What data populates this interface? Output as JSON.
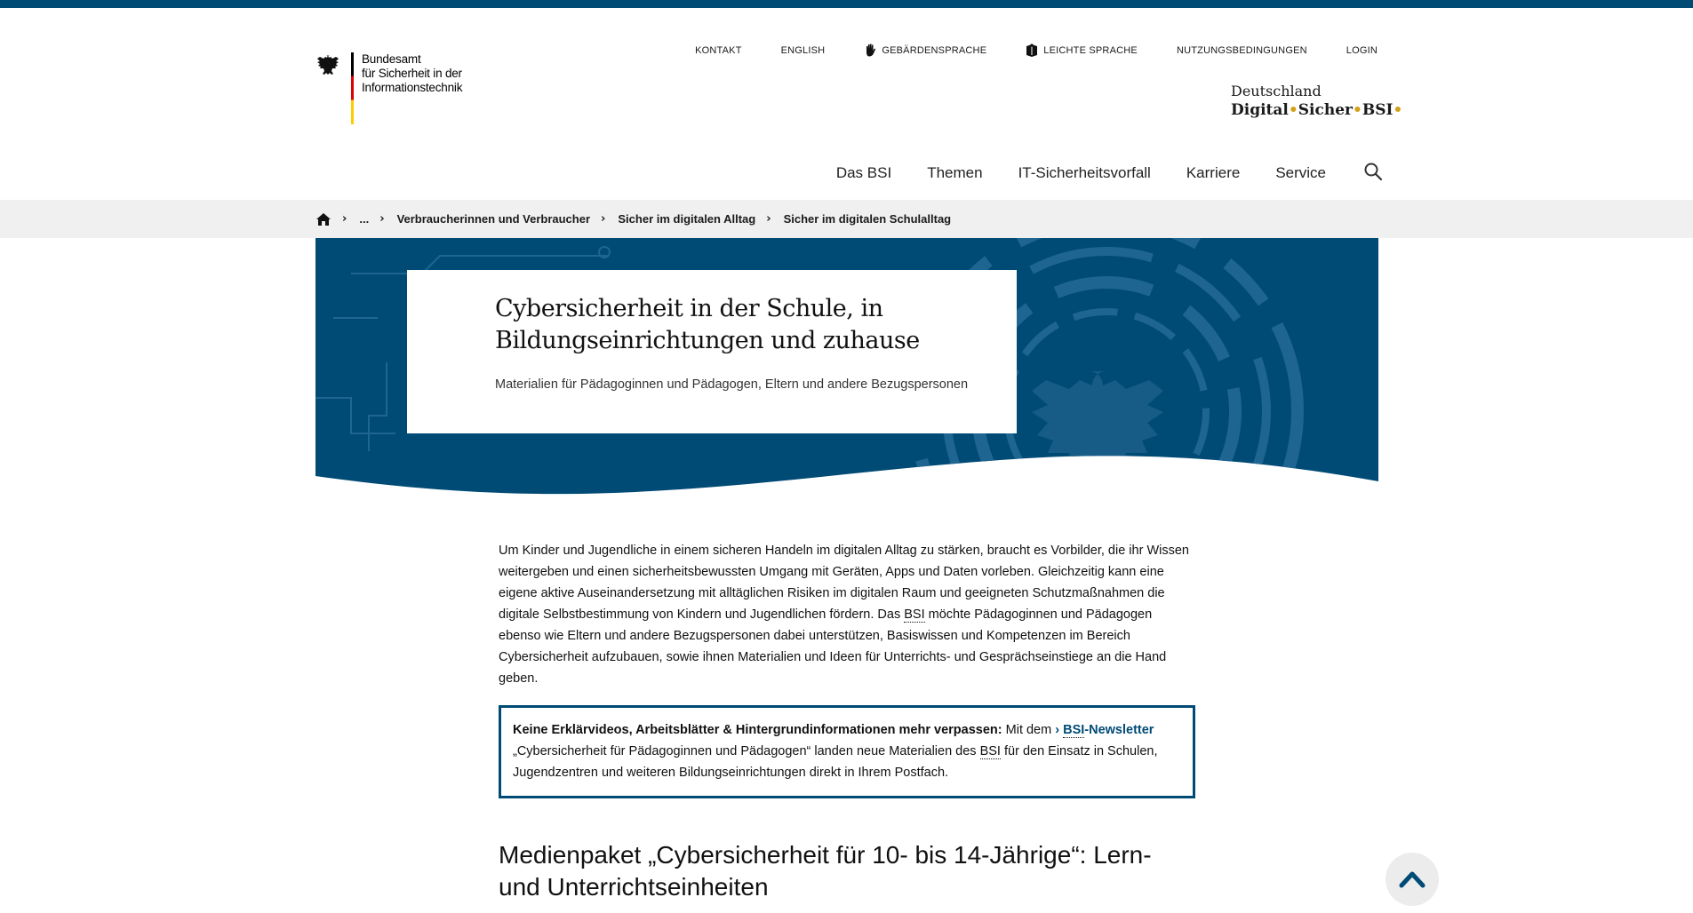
{
  "header": {
    "logo_lines": [
      "Bundesamt",
      "für Sicherheit in der",
      "Informationstechnik"
    ],
    "util_nav": [
      {
        "label": "KONTAKT",
        "icon": ""
      },
      {
        "label": "ENGLISH",
        "icon": ""
      },
      {
        "label": "GEBÄRDENSPRACHE",
        "icon": "sign-language-hand-icon"
      },
      {
        "label": "LEICHTE SPRACHE",
        "icon": "easy-language-book-icon"
      },
      {
        "label": "NUTZUNGSBEDINGUNGEN",
        "icon": ""
      },
      {
        "label": "LOGIN",
        "icon": ""
      }
    ],
    "brand_line1": "Deutschland",
    "brand_part1": "Digital",
    "brand_part2": "Sicher",
    "brand_part3": "BSI",
    "brand_dot": "•",
    "main_nav": [
      "Das BSI",
      "Themen",
      "IT-Sicherheitsvorfall",
      "Karriere",
      "Service"
    ]
  },
  "breadcrumb": {
    "items": [
      "...",
      "Verbraucherinnen und Verbraucher",
      "Sicher im digitalen Alltag",
      "Sicher im digitalen Schulalltag"
    ]
  },
  "hero": {
    "title_line1": "Cybersicherheit in der Schule, in",
    "title_line2": "Bildungseinrichtungen und zuhause",
    "subtitle": "Materialien für Pädagoginnen und Pädagogen, Eltern und andere Bezugspersonen"
  },
  "content": {
    "intro_part1": "Um Kinder und Jugendliche in einem sicheren Handeln im digitalen Alltag zu stärken, braucht es Vorbilder, die ihr Wissen weitergeben und einen sicherheitsbewussten Umgang mit Geräten, Apps und Daten vorleben. Gleichzeitig kann eine eigene aktive Auseinandersetzung mit alltäglichen Risiken im digitalen Raum und geeigneten Schutzmaßnahmen die digitale Selbstbestimmung von Kindern und Jugendlichen fördern. Das ",
    "intro_abbr": "BSI",
    "intro_part2": " möchte Pädagoginnen und Pädagogen ebenso wie Eltern und andere Bezugspersonen dabei unterstützen, Basiswissen und Kompetenzen im Bereich Cybersicherheit aufzubauen, sowie ihnen Materialien und Ideen für Unterrichts- und Gesprächseinstiege an die Hand geben.",
    "notice_bold": "Keine Erklärvideos, Arbeitsblätter & Hintergrundinformationen mehr verpassen:",
    "notice_pre_link": " Mit dem ",
    "notice_link_arrow": "›",
    "notice_link_abbr": "BSI",
    "notice_link_rest": "-Newsletter",
    "notice_mid": " „Cybersicherheit für Pädagoginnen und Pädagogen“ landen neue Materialien des ",
    "notice_abbr": "BSI",
    "notice_end": " für den Einsatz in Schulen, Jugendzentren und weiteren Bildungseinrichtungen direkt in Ihrem Postfach.",
    "section_title": "Medienpaket „Cybersicherheit für 10- bis 14-Jährige“: Lern- und Unterrichtseinheiten"
  },
  "colors": {
    "brand_blue": "#004b76",
    "breadcrumb_bg": "#f0f0f0",
    "accent_gold": "#d4a017"
  }
}
